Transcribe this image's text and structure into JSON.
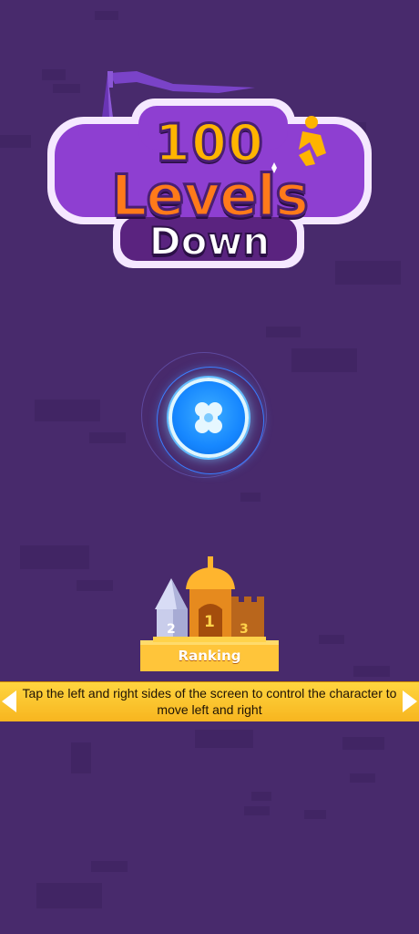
{
  "logo": {
    "line1": "100",
    "line2": "Levels",
    "line3": "Down"
  },
  "ranking": {
    "label": "Ranking",
    "places": [
      "2",
      "1",
      "3"
    ]
  },
  "hint": {
    "text": "Tap the left and right sides of the screen to control the character to move left and right"
  },
  "colors": {
    "background": "#482a6c",
    "banner": "#f9c02b",
    "play_button": "#1687ff",
    "logo_orange": "#ff7a1a",
    "logo_yellow": "#ffb400"
  },
  "icons": {
    "play": "clover-icon",
    "banner_left": "arrow-left-icon",
    "banner_right": "arrow-right-icon"
  }
}
